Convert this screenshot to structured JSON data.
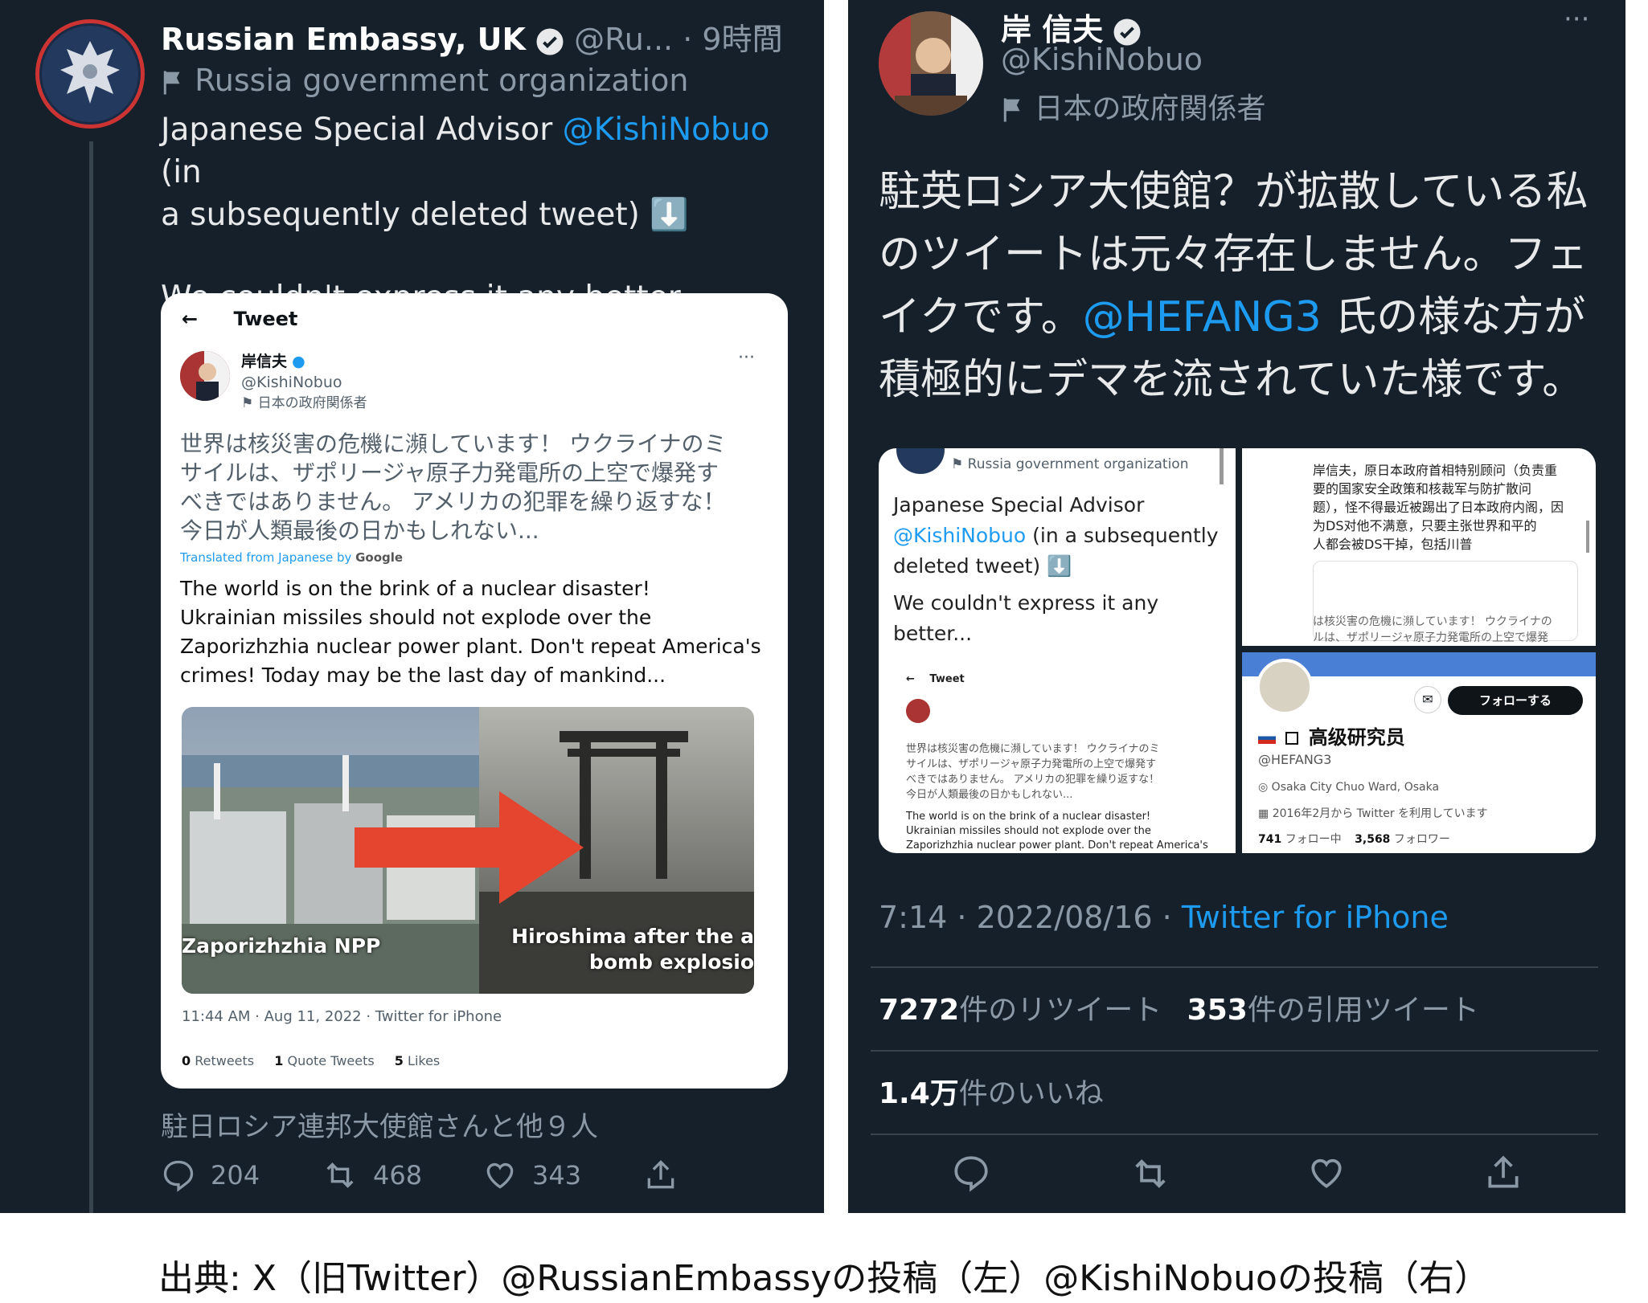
{
  "left_tweet": {
    "author_name": "Russian Embassy, UK",
    "handle": "@Ru...",
    "time": "· 9時間",
    "more": "···",
    "affiliation": "Russia government organization",
    "text_line1_a": "Japanese Special Advisor ",
    "text_line1_mention": "@KishiNobuo",
    "text_line1_b": " (in",
    "text_line2": "a subsequently deleted tweet) ⬇️",
    "text_line3": "We couldn't express it any better...",
    "embedded": {
      "back_arrow": "←",
      "header": "Tweet",
      "author_name": "岸信夫",
      "handle": "@KishiNobuo",
      "affiliation": "日本の政府関係者",
      "more": "···",
      "jp_lines": [
        "世界は核災害の危機に瀕しています！ ウクライナのミ",
        "サイルは、ザポリージャ原子力発電所の上空で爆発す",
        "べきではありません。 アメリカの犯罪を繰り返すな！",
        "今日が人類最後の日かもしれない..."
      ],
      "translated_prefix": "Translated from Japanese by ",
      "translated_google": "Google",
      "en_lines": [
        "The world is on the brink of a nuclear disaster!",
        "Ukrainian missiles should not explode over the",
        "Zaporizhzhia nuclear power plant. Don't repeat America's",
        "crimes! Today may be the last day of mankind..."
      ],
      "image_label_left": "Zaporizhzhia NPP",
      "image_label_right_1": "Hiroshima after the a",
      "image_label_right_2": "bomb explosio",
      "meta": "11:44 AM · Aug 11, 2022 · Twitter for iPhone",
      "stats": [
        {
          "num": "0",
          "label": "Retweets"
        },
        {
          "num": "1",
          "label": "Quote Tweets"
        },
        {
          "num": "5",
          "label": "Likes"
        }
      ]
    },
    "liked_by": "駐日ロシア連邦大使館さんと他９人",
    "actions": [
      {
        "icon": "reply-icon",
        "count": "204"
      },
      {
        "icon": "retweet-icon",
        "count": "468"
      },
      {
        "icon": "heart-icon",
        "count": "343"
      },
      {
        "icon": "share-icon",
        "count": ""
      }
    ]
  },
  "right_tweet": {
    "author_name": "岸 信夫",
    "handle": "@KishiNobuo",
    "affiliation": "日本の政府関係者",
    "more": "···",
    "text_lines": [
      "駐英ロシア大使館？が拡散している私",
      "のツイートは元々存在しません。フェ"
    ],
    "text_line3_a": "イクです。",
    "text_line3_mention": "@HEFANG3",
    "text_line3_b": " 氏の様な方が",
    "text_line4": "積極的にデマを流されていた様です。",
    "img1": {
      "affiliation": "Russia government organization",
      "lines": [
        "Japanese Special Advisor"
      ],
      "mention": "@KishiNobuo",
      "mention_rest": " (in a subsequently",
      "line3": "deleted tweet) ⬇️",
      "line4": "We couldn't express it any better...",
      "tweet_header": "Tweet",
      "jp_lines": [
        "世界は核災害の危機に瀕しています！ ウクライナのミ",
        "サイルは、ザポリージャ原子力発電所の上空で爆発す",
        "べきではありません。 アメリカの犯罪を繰り返すな！",
        "今日が人類最後の日かもしれない..."
      ],
      "en_lines": [
        "The world is on the brink of a nuclear disaster!",
        "Ukrainian missiles should not explode over the",
        "Zaporizhzhia nuclear power plant. Don't repeat America's"
      ]
    },
    "img2": {
      "lines": [
        "岸信夫，原日本政府首相特别顾问（负责重",
        "要的国家安全政策和核裁军与防扩散问",
        "题），怪不得最近被踢出了日本政府内阁，因",
        "为DS对他不满意，只要主张世界和平的",
        "人都会被DS干掉，包括川普"
      ],
      "bottom_lines": [
        "は核災害の危機に瀕しています！ ウクライナの",
        "ルは、ザポリージャ原子力発電所の上空で爆発"
      ]
    },
    "img3": {
      "follow_label": "フォローする",
      "name": "高级研究员",
      "handle": "@HEFANG3",
      "location": "Osaka City Chuo Ward, Osaka",
      "joined": "2016年2月から Twitter を利用しています",
      "following_num": "741",
      "following_label": "フォロー中",
      "followers_num": "3,568",
      "followers_label": "フォロワー"
    },
    "meta_time": "7:14 · 2022/08/16 · ",
    "meta_source": "Twitter for iPhone",
    "retweets_num": "7272",
    "retweets_label": "件のリツイート",
    "quotes_num": "353",
    "quotes_label": "件の引用ツイート",
    "likes_num": "1.4万",
    "likes_label": "件のいいね",
    "actions": [
      "reply-icon",
      "retweet-icon",
      "heart-icon",
      "share-icon"
    ]
  },
  "caption": "出典: X（旧Twitter）@RussianEmbassyの投稿（左）@KishiNobuoの投稿（右）",
  "colors": {
    "background": "#15202b",
    "link": "#1d9bf0",
    "muted": "#8b98a5",
    "text": "#e7e9ea"
  }
}
